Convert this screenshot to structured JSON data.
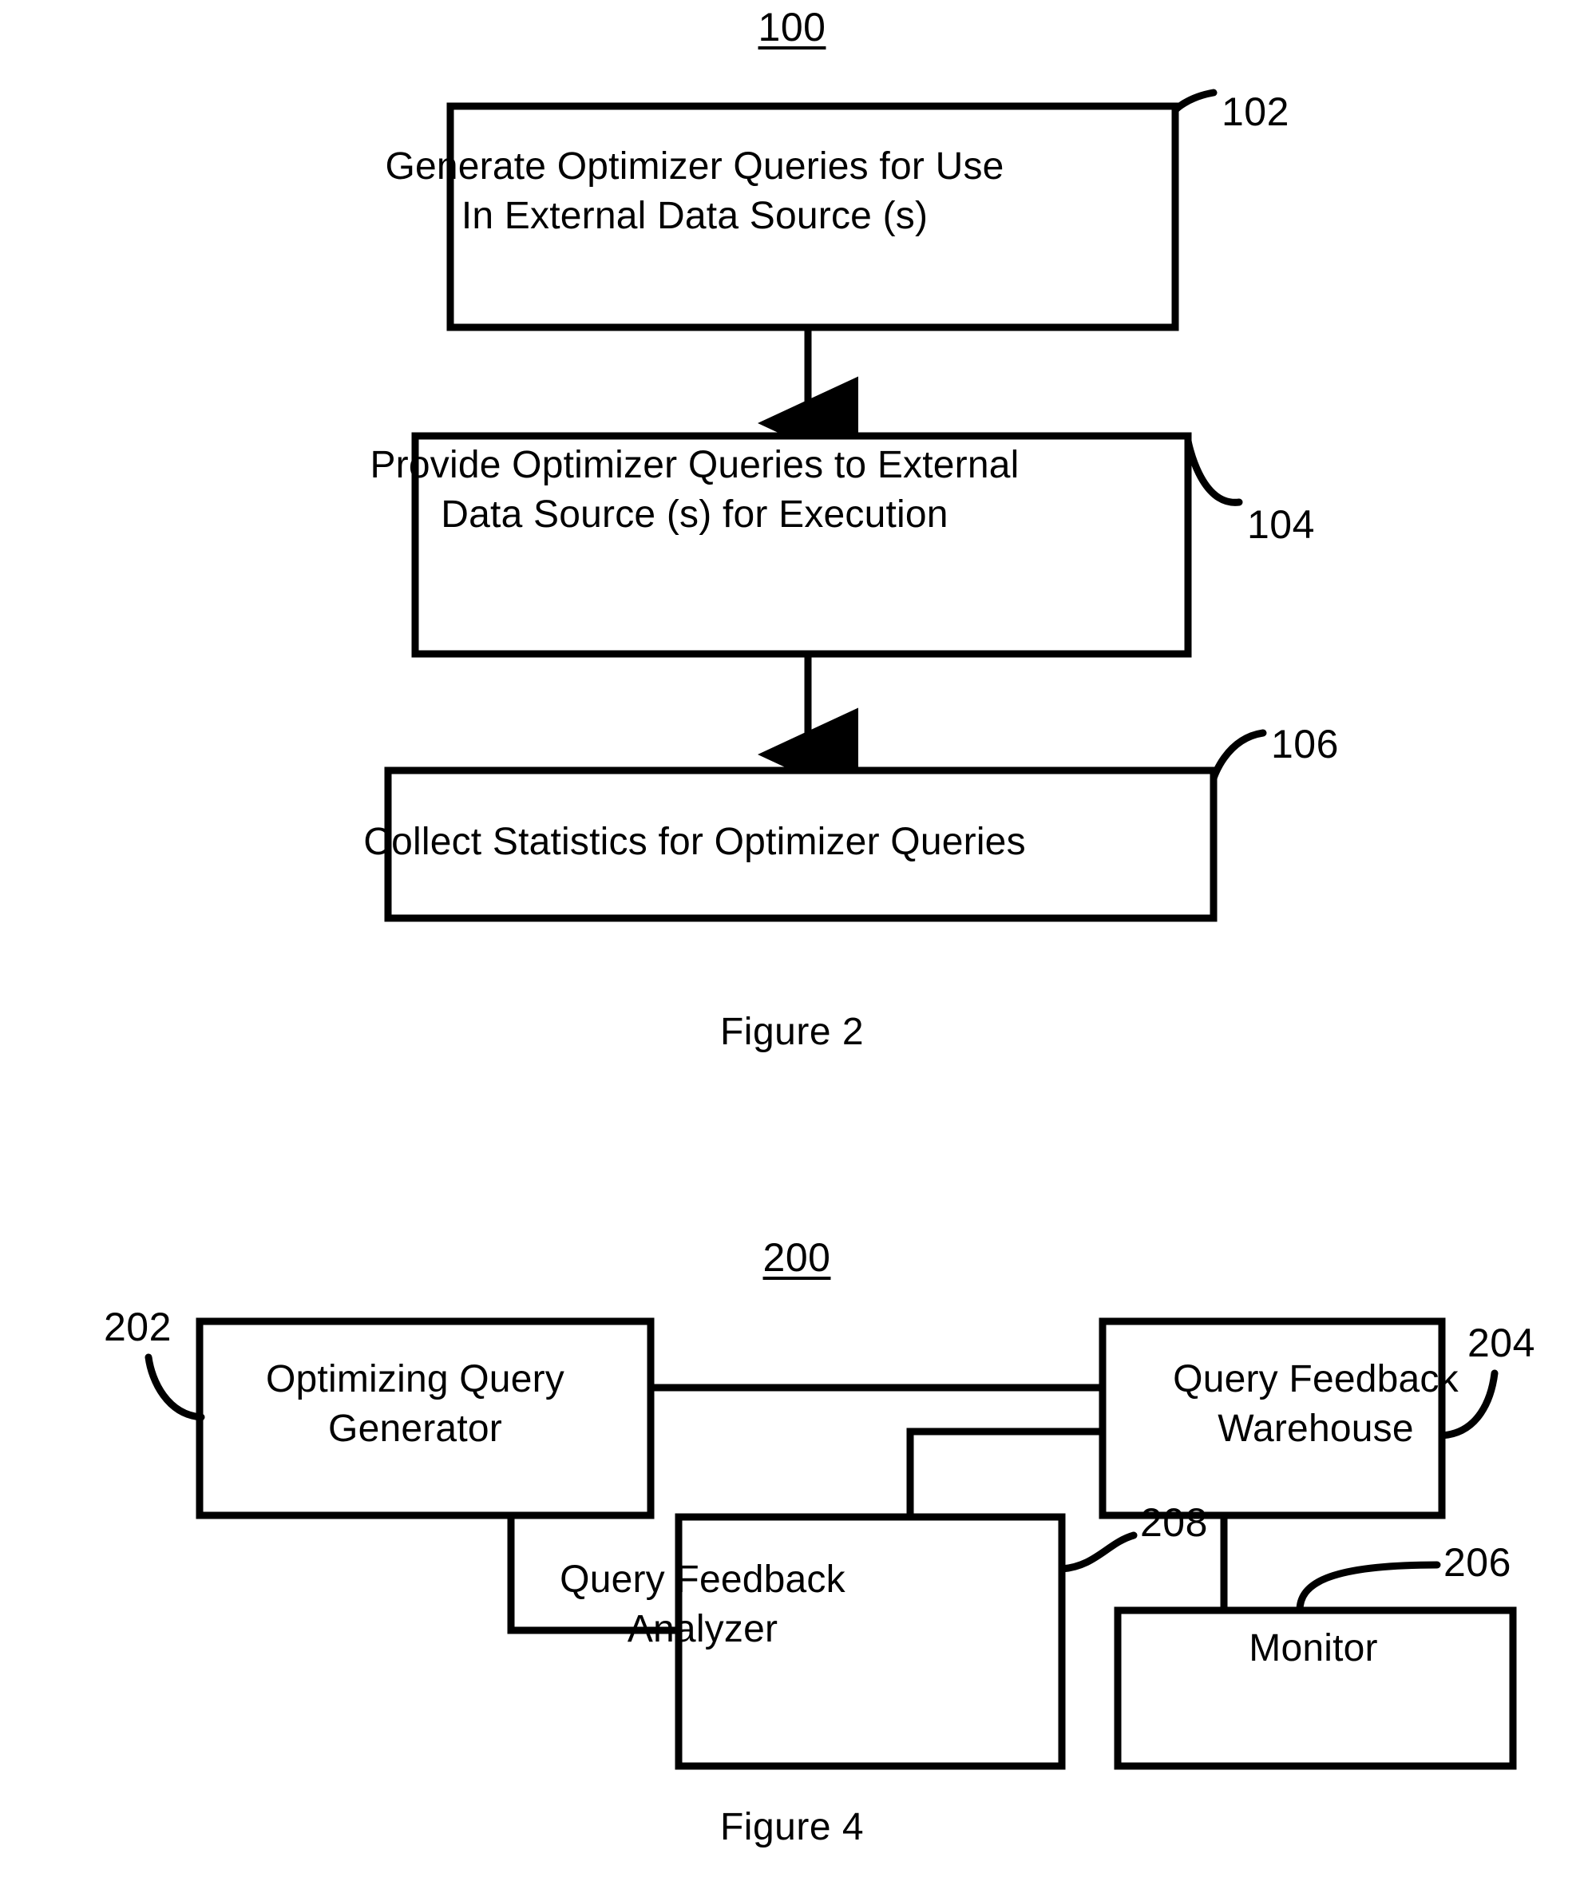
{
  "figure_2": {
    "reference_numeral": "100",
    "caption": "Figure 2",
    "steps": [
      {
        "numeral": "102",
        "text": "Generate Optimizer Queries for Use\nIn External Data Source  (s)"
      },
      {
        "numeral": "104",
        "text": "Provide Optimizer Queries to External\nData Source (s) for Execution"
      },
      {
        "numeral": "106",
        "text": "Collect Statistics for Optimizer Queries"
      }
    ]
  },
  "figure_4": {
    "reference_numeral": "200",
    "caption": "Figure 4",
    "blocks": [
      {
        "numeral": "202",
        "text": "Optimizing Query\nGenerator"
      },
      {
        "numeral": "204",
        "text": "Query Feedback\nWarehouse"
      },
      {
        "numeral": "208",
        "text": "Query Feedback\nAnalyzer"
      },
      {
        "numeral": "206",
        "text": "Monitor"
      }
    ]
  },
  "colors": {
    "ink": "#000000",
    "paper": "#ffffff"
  }
}
